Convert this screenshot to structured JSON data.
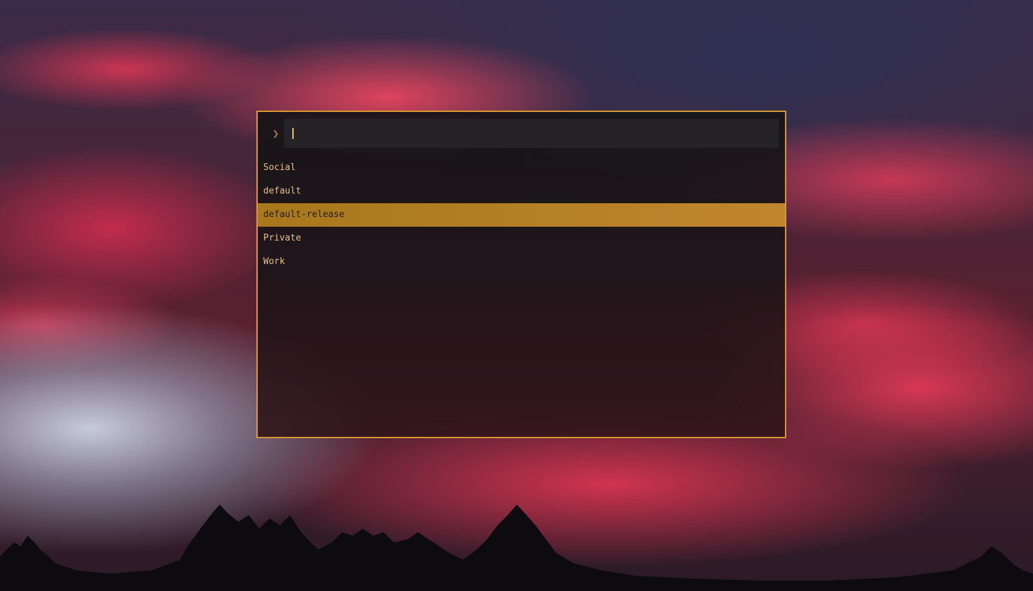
{
  "launcher": {
    "prompt_symbol": "❯",
    "query": "",
    "accent_color": "#d89a2e",
    "items": [
      {
        "label": "Social",
        "selected": false
      },
      {
        "label": "default",
        "selected": false
      },
      {
        "label": "default-release",
        "selected": true
      },
      {
        "label": "Private",
        "selected": false
      },
      {
        "label": "Work",
        "selected": false
      }
    ]
  }
}
